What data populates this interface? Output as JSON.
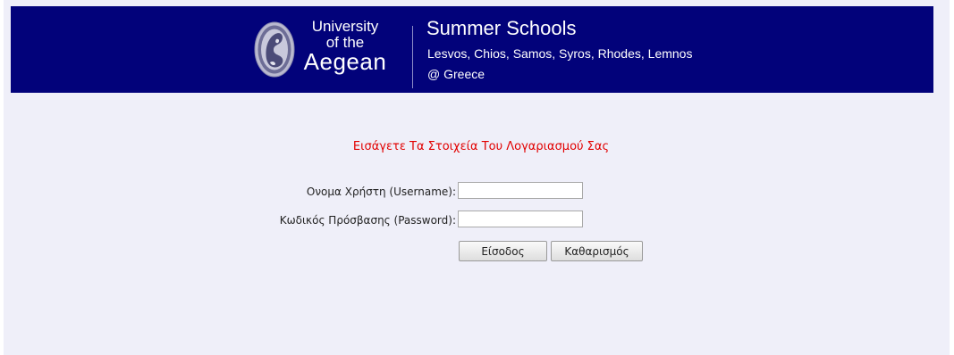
{
  "header": {
    "logo_name": "university-of-the-aegean-seal",
    "university": {
      "line1": "University",
      "line2": "of the",
      "line3": "Aegean"
    },
    "summer_schools": {
      "title": "Summer Schools",
      "islands": "Lesvos, Chios, Samos, Syros, Rhodes, Lemnos",
      "country": "@ Greece"
    }
  },
  "login_form": {
    "heading": "Εισάγετε Τα Στοιχεία Του Λογαριασμού Σας",
    "username_label": "Ονομα Χρήστη (Username):",
    "username_value": "",
    "password_label": "Κωδικός Πρόσβασης (Password):",
    "password_value": "",
    "submit_label": "Είσοδος",
    "reset_label": "Καθαρισμός"
  },
  "colors": {
    "banner": "#02027a",
    "page_background": "#efeff9",
    "heading_text": "#e20000"
  }
}
